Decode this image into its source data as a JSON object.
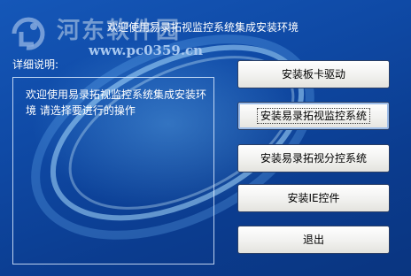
{
  "window": {
    "title": "欢迎使用易录拓视监控系统集成安装环境"
  },
  "watermark": {
    "site": "河东软件园",
    "url": "www.pc0359.cn"
  },
  "details": {
    "label": "详细说明:",
    "text": "欢迎使用易录拓视监控系统集成安装环境   请选择要进行的操作"
  },
  "buttons": [
    {
      "label": "安装板卡驱动"
    },
    {
      "label": "安装易录拓视监控系统"
    },
    {
      "label": "安装易录拓视分控系统"
    },
    {
      "label": "安装IE控件"
    },
    {
      "label": "退出"
    }
  ],
  "colors": {
    "background": "#0f4aa6",
    "text": "#ffffff",
    "button_face": "#f1f1ef"
  }
}
